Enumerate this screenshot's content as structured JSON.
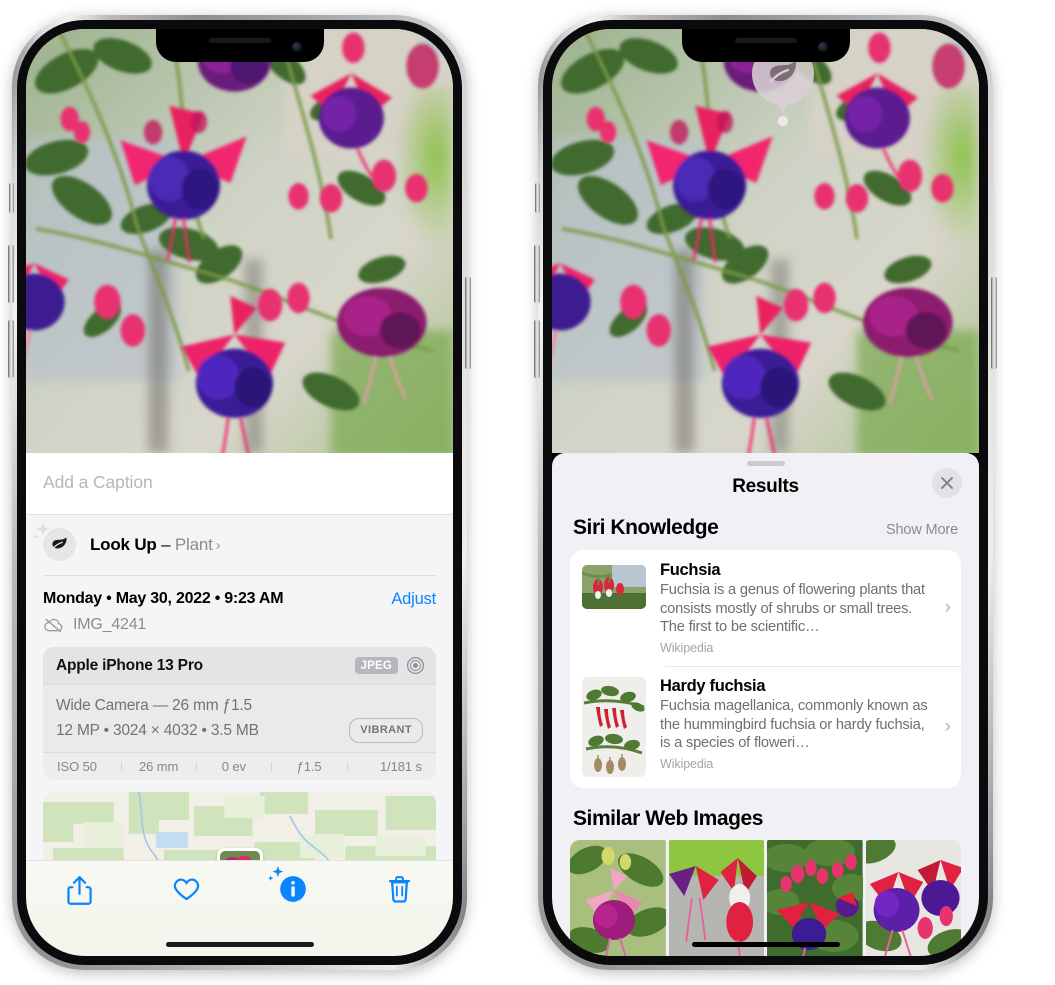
{
  "app": "Photos - Visual Look Up",
  "left_phone": {
    "photo": {
      "alt_name": "fuchsia-flowers-photo"
    },
    "caption": {
      "placeholder": "Add a Caption",
      "value": ""
    },
    "look_up": {
      "label_bold": "Look Up",
      "separator": " – ",
      "subject": "Plant",
      "chevron": "›",
      "icon": "leaf-icon"
    },
    "meta": {
      "date": "Monday • May 30, 2022 • 9:23 AM",
      "adjust_label": "Adjust",
      "filename": "IMG_4241",
      "cloud_icon": "cloud-slash-icon"
    },
    "exif": {
      "device": "Apple iPhone 13 Pro",
      "format_badge": "JPEG",
      "lens_icon": "aperture-icon",
      "lens_line": "Wide Camera — 26 mm ƒ1.5",
      "specs_line": "12 MP • 3024 × 4032 • 3.5 MB",
      "style_badge": "VIBRANT",
      "stats": [
        "ISO 50",
        "26 mm",
        "0 ev",
        "ƒ1.5",
        "1/181 s"
      ]
    },
    "map": {
      "name": "location-map-preview"
    },
    "toolbar": [
      {
        "name": "share-button",
        "icon": "share-icon"
      },
      {
        "name": "favorite-button",
        "icon": "heart-icon"
      },
      {
        "name": "info-button",
        "icon": "info-sparkle-icon"
      },
      {
        "name": "delete-button",
        "icon": "trash-icon"
      }
    ],
    "accent_color": "#0a84ff"
  },
  "right_phone": {
    "photo_badge": {
      "icon": "leaf-icon",
      "name": "visual-lookup-badge"
    },
    "sheet": {
      "title": "Results",
      "close_icon": "close-icon",
      "sections": [
        {
          "title": "Siri Knowledge",
          "action": "Show More",
          "items": [
            {
              "title": "Fuchsia",
              "description": "Fuchsia is a genus of flowering plants that consists mostly of shrubs or small trees. The first to be scientific…",
              "source": "Wikipedia",
              "thumb": "fuchsia-red-flowers-thumb"
            },
            {
              "title": "Hardy fuchsia",
              "description": "Fuchsia magellanica, commonly known as the hummingbird fuchsia or hardy fuchsia, is a species of floweri…",
              "source": "Wikipedia",
              "thumb": "hardy-fuchsia-branch-thumb"
            }
          ]
        },
        {
          "title": "Similar Web Images",
          "images": [
            "web-image-1",
            "web-image-2",
            "web-image-3",
            "web-image-4"
          ]
        }
      ]
    }
  }
}
